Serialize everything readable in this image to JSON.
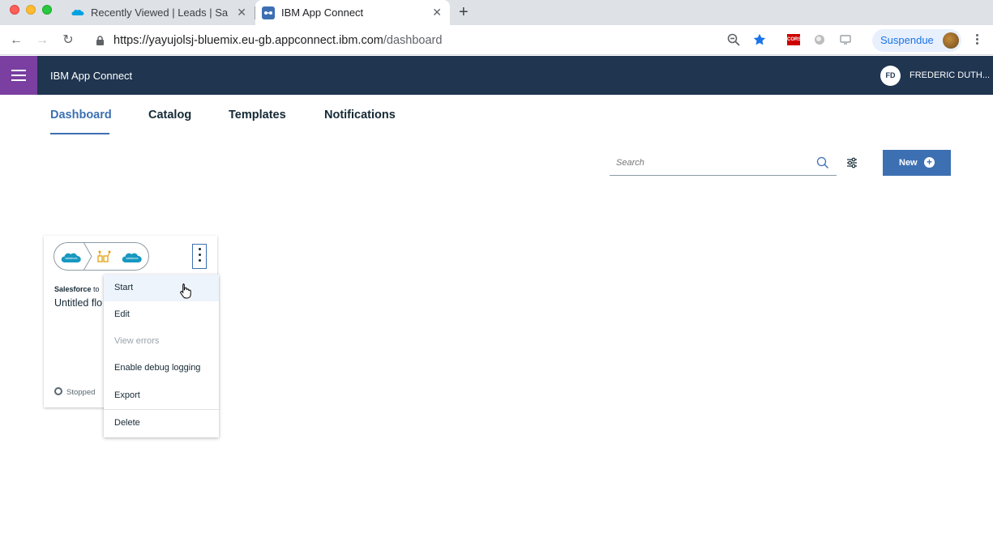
{
  "browser": {
    "tabs": [
      {
        "title": "Recently Viewed | Leads | Sale",
        "active": false
      },
      {
        "title": "IBM App Connect",
        "active": true
      }
    ],
    "url_host": "https://yayujolsj-bluemix.eu-gb.appconnect.ibm.com",
    "url_path": "/dashboard",
    "profile_label": "Suspendue",
    "extension_cors": "CORS",
    "colors": {
      "star": "#1a73e8",
      "profile": "#1a73e8"
    }
  },
  "app": {
    "title": "IBM App Connect",
    "user_initials": "FD",
    "user_name": "FREDERIC DUTH...",
    "colors": {
      "header": "#1f3550",
      "hamburger": "#7a3fa0",
      "accent": "#3d70b2"
    }
  },
  "main_tabs": [
    {
      "label": "Dashboard",
      "active": true
    },
    {
      "label": "Catalog",
      "active": false
    },
    {
      "label": "Templates",
      "active": false
    },
    {
      "label": "Notifications",
      "active": false
    }
  ],
  "search": {
    "placeholder": "Search"
  },
  "new_button": {
    "label": "New"
  },
  "flow_card": {
    "title_bold": "Salesforce",
    "title_rest": " to",
    "name": "Untitled flo",
    "status": "Stopped",
    "icons": [
      "salesforce-icon",
      "batch-icon",
      "salesforce-icon"
    ]
  },
  "overflow_menu": {
    "items": [
      {
        "label": "Start",
        "state": "hover"
      },
      {
        "label": "Edit",
        "state": "normal"
      },
      {
        "label": "View errors",
        "state": "disabled"
      },
      {
        "label": "Enable debug logging",
        "state": "normal"
      },
      {
        "label": "Export",
        "state": "normal"
      },
      {
        "label": "Delete",
        "state": "normal"
      }
    ]
  }
}
